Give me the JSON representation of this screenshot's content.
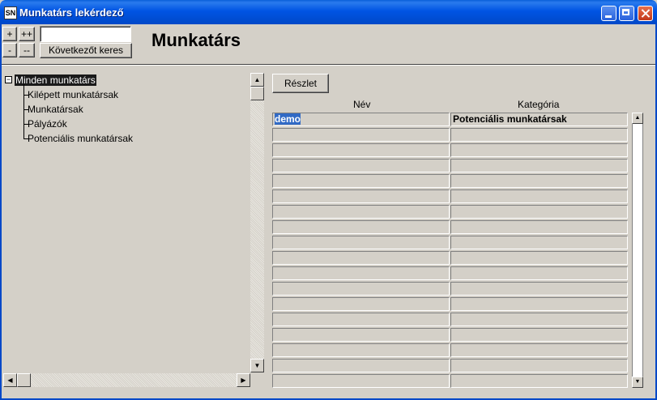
{
  "window": {
    "title": "Munkatárs lekérdező",
    "icon_text": "SN"
  },
  "toolbar": {
    "plus": "+",
    "plusplus": "++",
    "minus": "-",
    "minusminus": "--",
    "search_value": "",
    "next_search_label": "Következőt keres"
  },
  "page_title": "Munkatárs",
  "tree": {
    "expander": "−",
    "root": "Minden munkatárs",
    "children": [
      "Kilépett munkatársak",
      "Munkatársak",
      "Pályázók",
      "Potenciális munkatársak"
    ]
  },
  "detail_button": "Részlet",
  "grid": {
    "headers": [
      "Név",
      "Kategória"
    ],
    "rows": [
      [
        "demo",
        "Potenciális munkatársak"
      ]
    ],
    "empty_rows": 17
  },
  "scroll": {
    "up": "▲",
    "down": "▼",
    "left": "◀",
    "right": "▶"
  }
}
